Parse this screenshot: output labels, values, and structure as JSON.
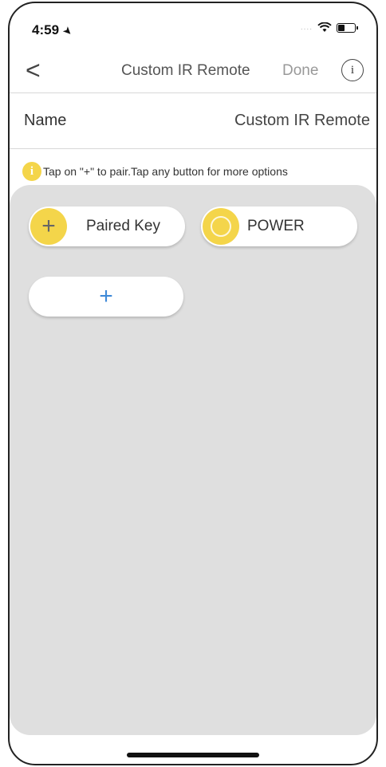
{
  "status_bar": {
    "time": "4:59",
    "location_arrow": "location-arrow-icon",
    "signal": "....",
    "wifi": "wifi-icon",
    "battery": "battery-icon"
  },
  "nav": {
    "back_icon": "chevron-left-icon",
    "back_glyph": "<",
    "title": "Custom IR Remote",
    "done_label": "Done",
    "info_icon": "info-icon",
    "info_glyph": "i"
  },
  "name_row": {
    "label": "Name",
    "value": "Custom IR Remote"
  },
  "hint": {
    "icon": "info-icon",
    "icon_glyph": "i",
    "text": "Tap on \"+\" to pair.Tap any button for more options"
  },
  "keys": [
    {
      "label": "Paired Key",
      "icon": "plus-icon",
      "glyph": "+"
    },
    {
      "label": "POWER",
      "icon": "power-ring-icon"
    }
  ],
  "add_key": {
    "icon": "plus-icon",
    "glyph": "+"
  },
  "colors": {
    "accent_yellow": "#f4d54a",
    "panel_bg": "#dfdfdf",
    "add_blue": "#3f8ad8"
  }
}
